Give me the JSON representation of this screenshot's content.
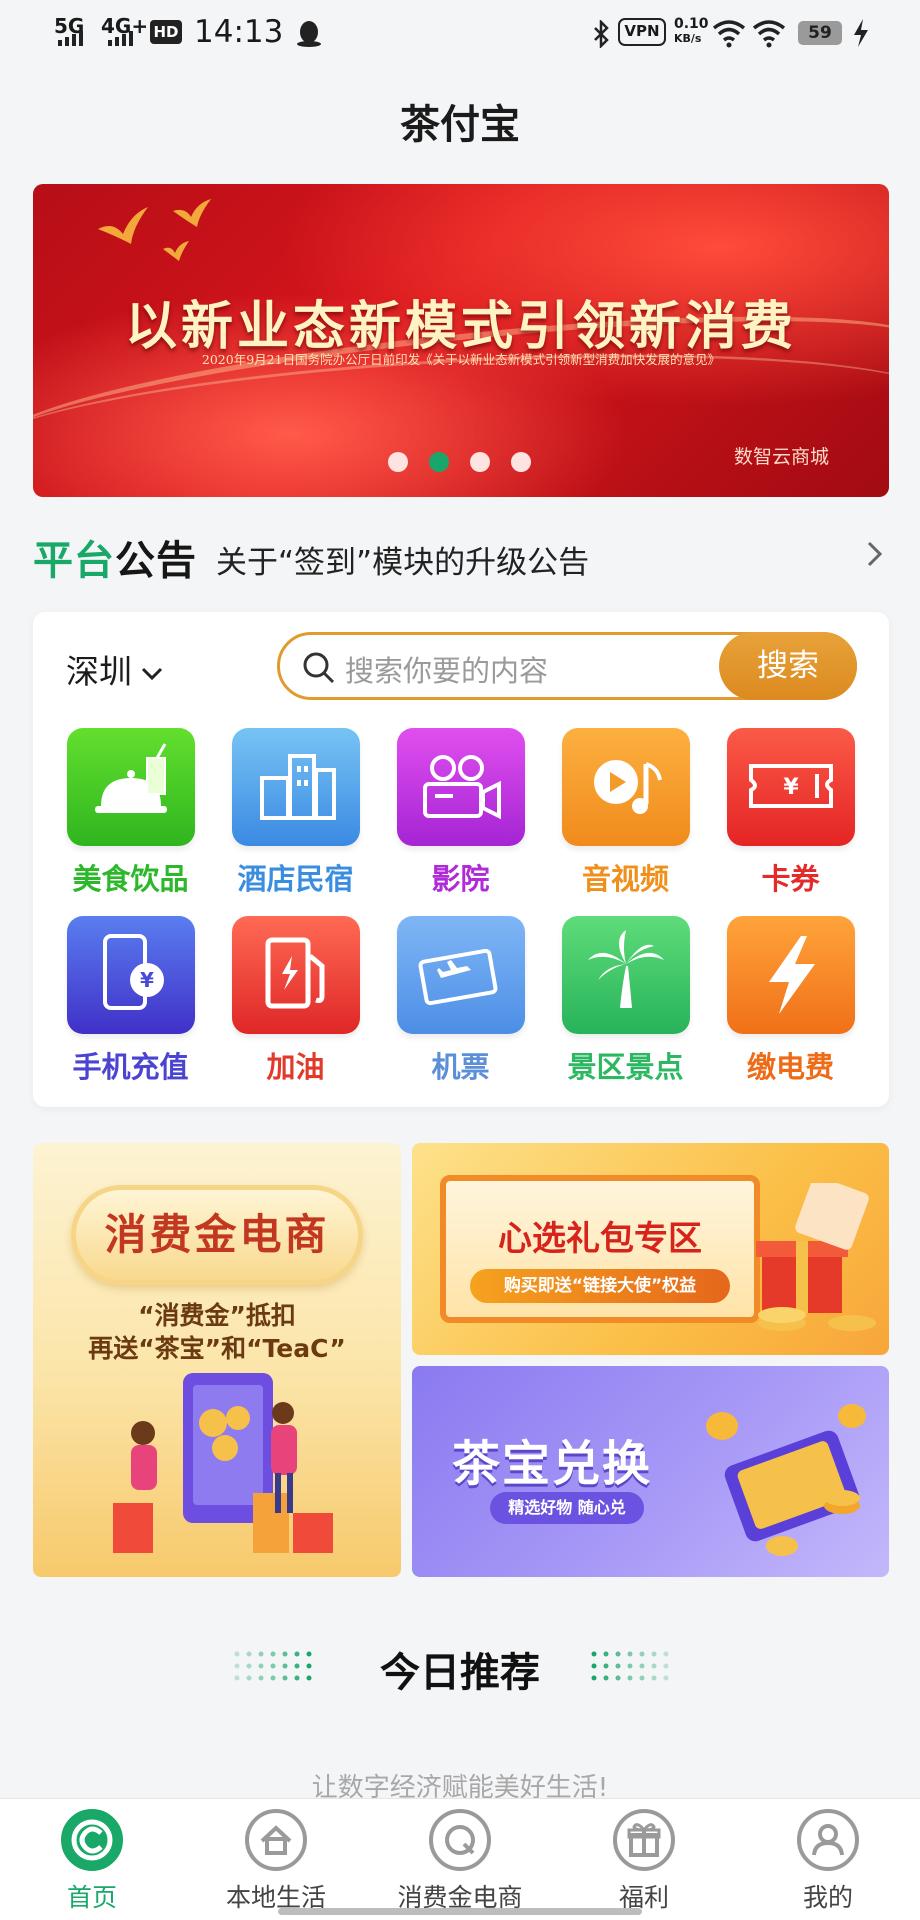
{
  "status_bar": {
    "signal1": "5G",
    "signal2": "4G+",
    "hd": "HD",
    "time": "14:13",
    "vpn": "VPN",
    "speed_value": "0.10",
    "speed_unit": "KB/s",
    "battery": "59"
  },
  "header": {
    "title": "茶付宝"
  },
  "banner": {
    "headline": "以新业态新模式引领新消费",
    "subline": "2020年9月21日国务院办公厅日前印发《关于以新业态新模式引领新型消费加快发展的意见》",
    "brand": "数智云商城",
    "slide_count": 4,
    "active_slide": 2
  },
  "notice": {
    "tag_green": "平台",
    "tag_black": "公告",
    "message": "关于“签到”模块的升级公告"
  },
  "services_card": {
    "city": "深圳",
    "search_placeholder": "搜索你要的内容",
    "search_button": "搜索",
    "items": [
      {
        "label": "美食饮品",
        "icon": "food-icon",
        "color": "#2fbe2a"
      },
      {
        "label": "酒店民宿",
        "icon": "hotel-icon",
        "color": "#3b8de0"
      },
      {
        "label": "影院",
        "icon": "cinema-icon",
        "color": "#b12ad8"
      },
      {
        "label": "音视频",
        "icon": "music-video-icon",
        "color": "#f08b1c"
      },
      {
        "label": "卡券",
        "icon": "coupon-icon",
        "color": "#e42b2b"
      },
      {
        "label": "手机充值",
        "icon": "phone-recharge-icon",
        "color": "#4a4ad8"
      },
      {
        "label": "加油",
        "icon": "fuel-icon",
        "color": "#e63b2a"
      },
      {
        "label": "机票",
        "icon": "plane-ticket-icon",
        "color": "#4d8ee6"
      },
      {
        "label": "景区景点",
        "icon": "palm-tree-icon",
        "color": "#2ec06a"
      },
      {
        "label": "缴电费",
        "icon": "lightning-icon",
        "color": "#f07018"
      }
    ]
  },
  "promos": {
    "left": {
      "title": "消费金电商",
      "line1": "“消费金”抵扣",
      "line2": "再送“茶宝”和“TeaC”"
    },
    "right_top": {
      "title": "心选礼包专区",
      "sub": "购买即送“链接大使”权益"
    },
    "right_bottom": {
      "title": "茶宝兑换",
      "sub": "精选好物 随心兑"
    }
  },
  "today": {
    "title": "今日推荐",
    "slogan": "让数字经济赋能美好生活!"
  },
  "tabbar": {
    "tabs": [
      {
        "label": "首页",
        "icon": "home-logo-icon"
      },
      {
        "label": "本地生活",
        "icon": "house-icon"
      },
      {
        "label": "消费金电商",
        "icon": "q-shop-icon"
      },
      {
        "label": "福利",
        "icon": "gift-icon"
      },
      {
        "label": "我的",
        "icon": "user-icon"
      }
    ],
    "active": 0
  }
}
